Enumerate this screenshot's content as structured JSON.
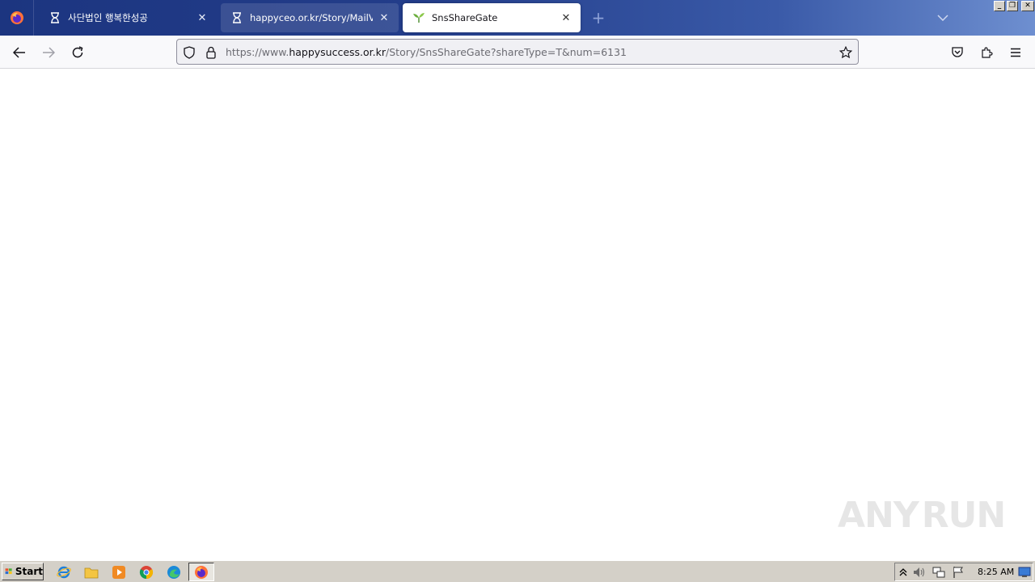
{
  "browser": {
    "tabs": [
      {
        "title": "사단법인 행복한성공",
        "active": false
      },
      {
        "title": "happyceo.or.kr/Story/MailView?nu",
        "active": false
      },
      {
        "title": "SnsShareGate",
        "active": true
      }
    ],
    "new_tab_label": "+",
    "url": {
      "prefix": "https://www.",
      "host": "happysuccess.or.kr",
      "path": "/Story/SnsShareGate?shareType=T&num=6131"
    }
  },
  "watermark": {
    "left": "ANY",
    "right": "RUN"
  },
  "taskbar": {
    "start_label": "Start",
    "clock": "8:25 AM"
  },
  "colors": {
    "tabstrip_start": "#1c3580",
    "tabstrip_end": "#6e8fd0",
    "urlbar_bg": "#f0f0f4",
    "taskbar_bg": "#d4d0c8"
  }
}
